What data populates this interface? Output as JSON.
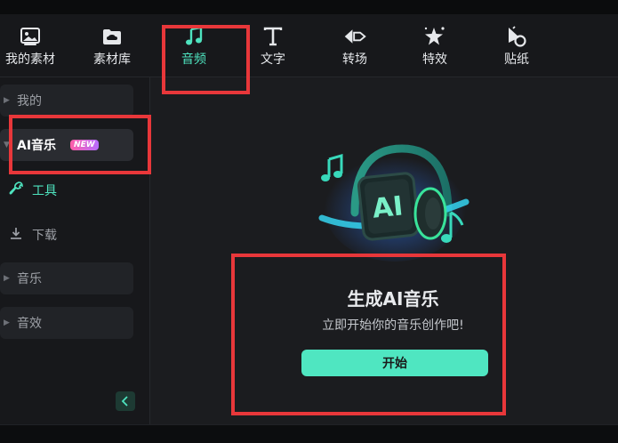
{
  "toolbar": {
    "items": [
      {
        "label": "我的素材",
        "icon": "image-icon"
      },
      {
        "label": "素材库",
        "icon": "cloud-folder-icon"
      },
      {
        "label": "音频",
        "icon": "music-note-icon"
      },
      {
        "label": "文字",
        "icon": "text-t-icon"
      },
      {
        "label": "转场",
        "icon": "transition-icon"
      },
      {
        "label": "特效",
        "icon": "sparkle-star-icon"
      },
      {
        "label": "贴纸",
        "icon": "sticker-icon"
      }
    ],
    "active": "音频"
  },
  "sidebar": {
    "items": [
      {
        "label": "我的"
      },
      {
        "label": "AI音乐",
        "badge": "NEW"
      },
      {
        "label": "工具",
        "icon": "wrench-icon"
      },
      {
        "label": "下载",
        "icon": "download-icon"
      },
      {
        "label": "音乐"
      },
      {
        "label": "音效"
      }
    ]
  },
  "main": {
    "illustration": "ai-headphones-illustration",
    "illustration_text": "AI",
    "title": "生成AI音乐",
    "subtitle": "立即开始你的音乐创作吧!",
    "start_label": "开始"
  },
  "colors": {
    "accent": "#4fe6c1",
    "highlight": "#e8373a",
    "badge_gradient": [
      "#ff5ea8",
      "#b56cff"
    ]
  }
}
